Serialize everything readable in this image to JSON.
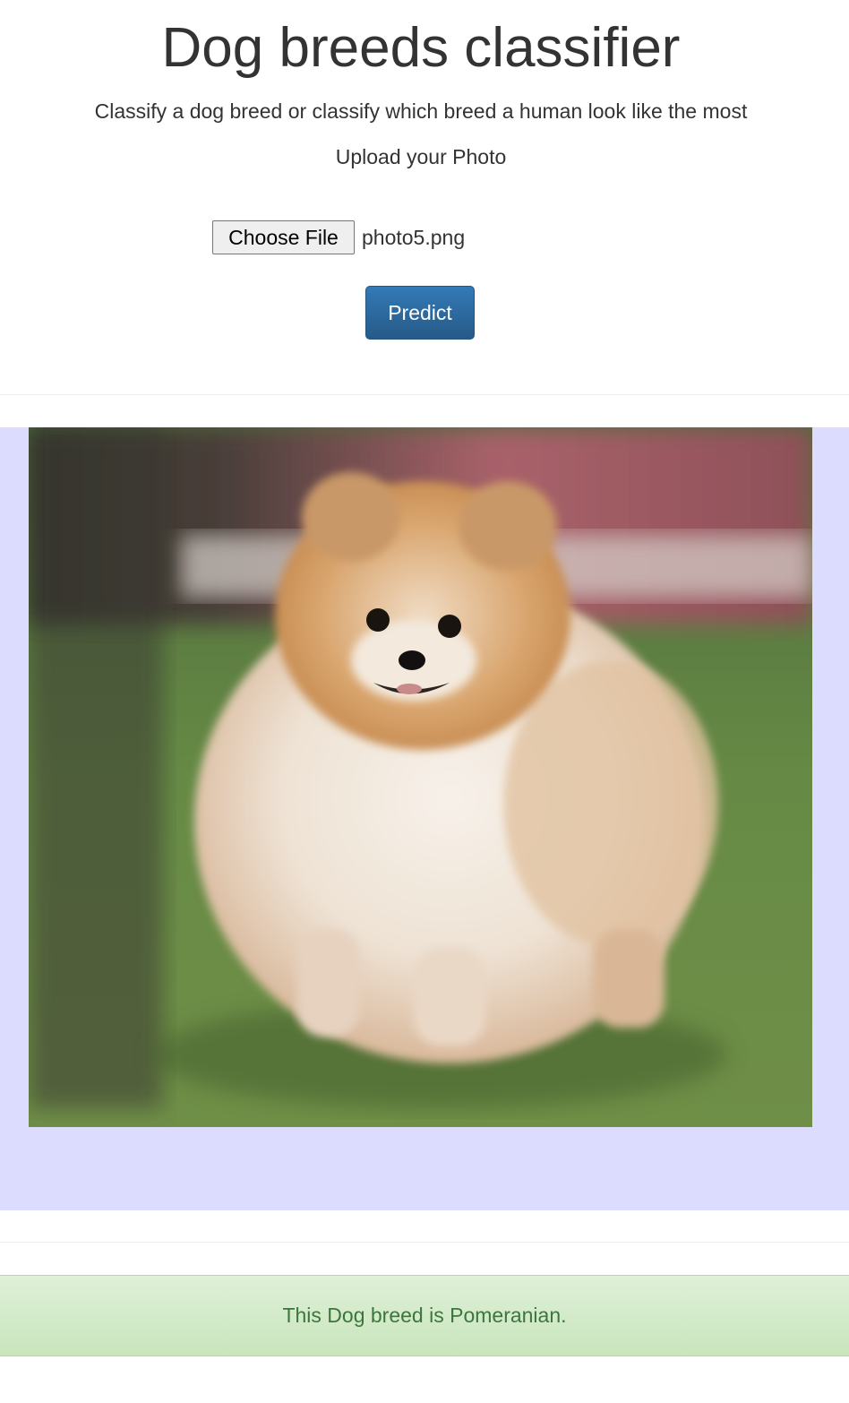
{
  "header": {
    "title": "Dog breeds classifier",
    "subtitle": "Classify a dog breed or classify which breed a human look like the most"
  },
  "upload": {
    "label": "Upload your Photo",
    "choose_button_label": "Choose File",
    "file_name": "photo5.png",
    "predict_button_label": "Predict"
  },
  "preview": {
    "panel_color": "#dcdcfe"
  },
  "result": {
    "message": "This Dog breed is Pomeranian.",
    "text_color": "#3c763d",
    "background_color": "#dff0d8"
  },
  "colors": {
    "primary_button": "#337ab7",
    "text": "#333333"
  }
}
